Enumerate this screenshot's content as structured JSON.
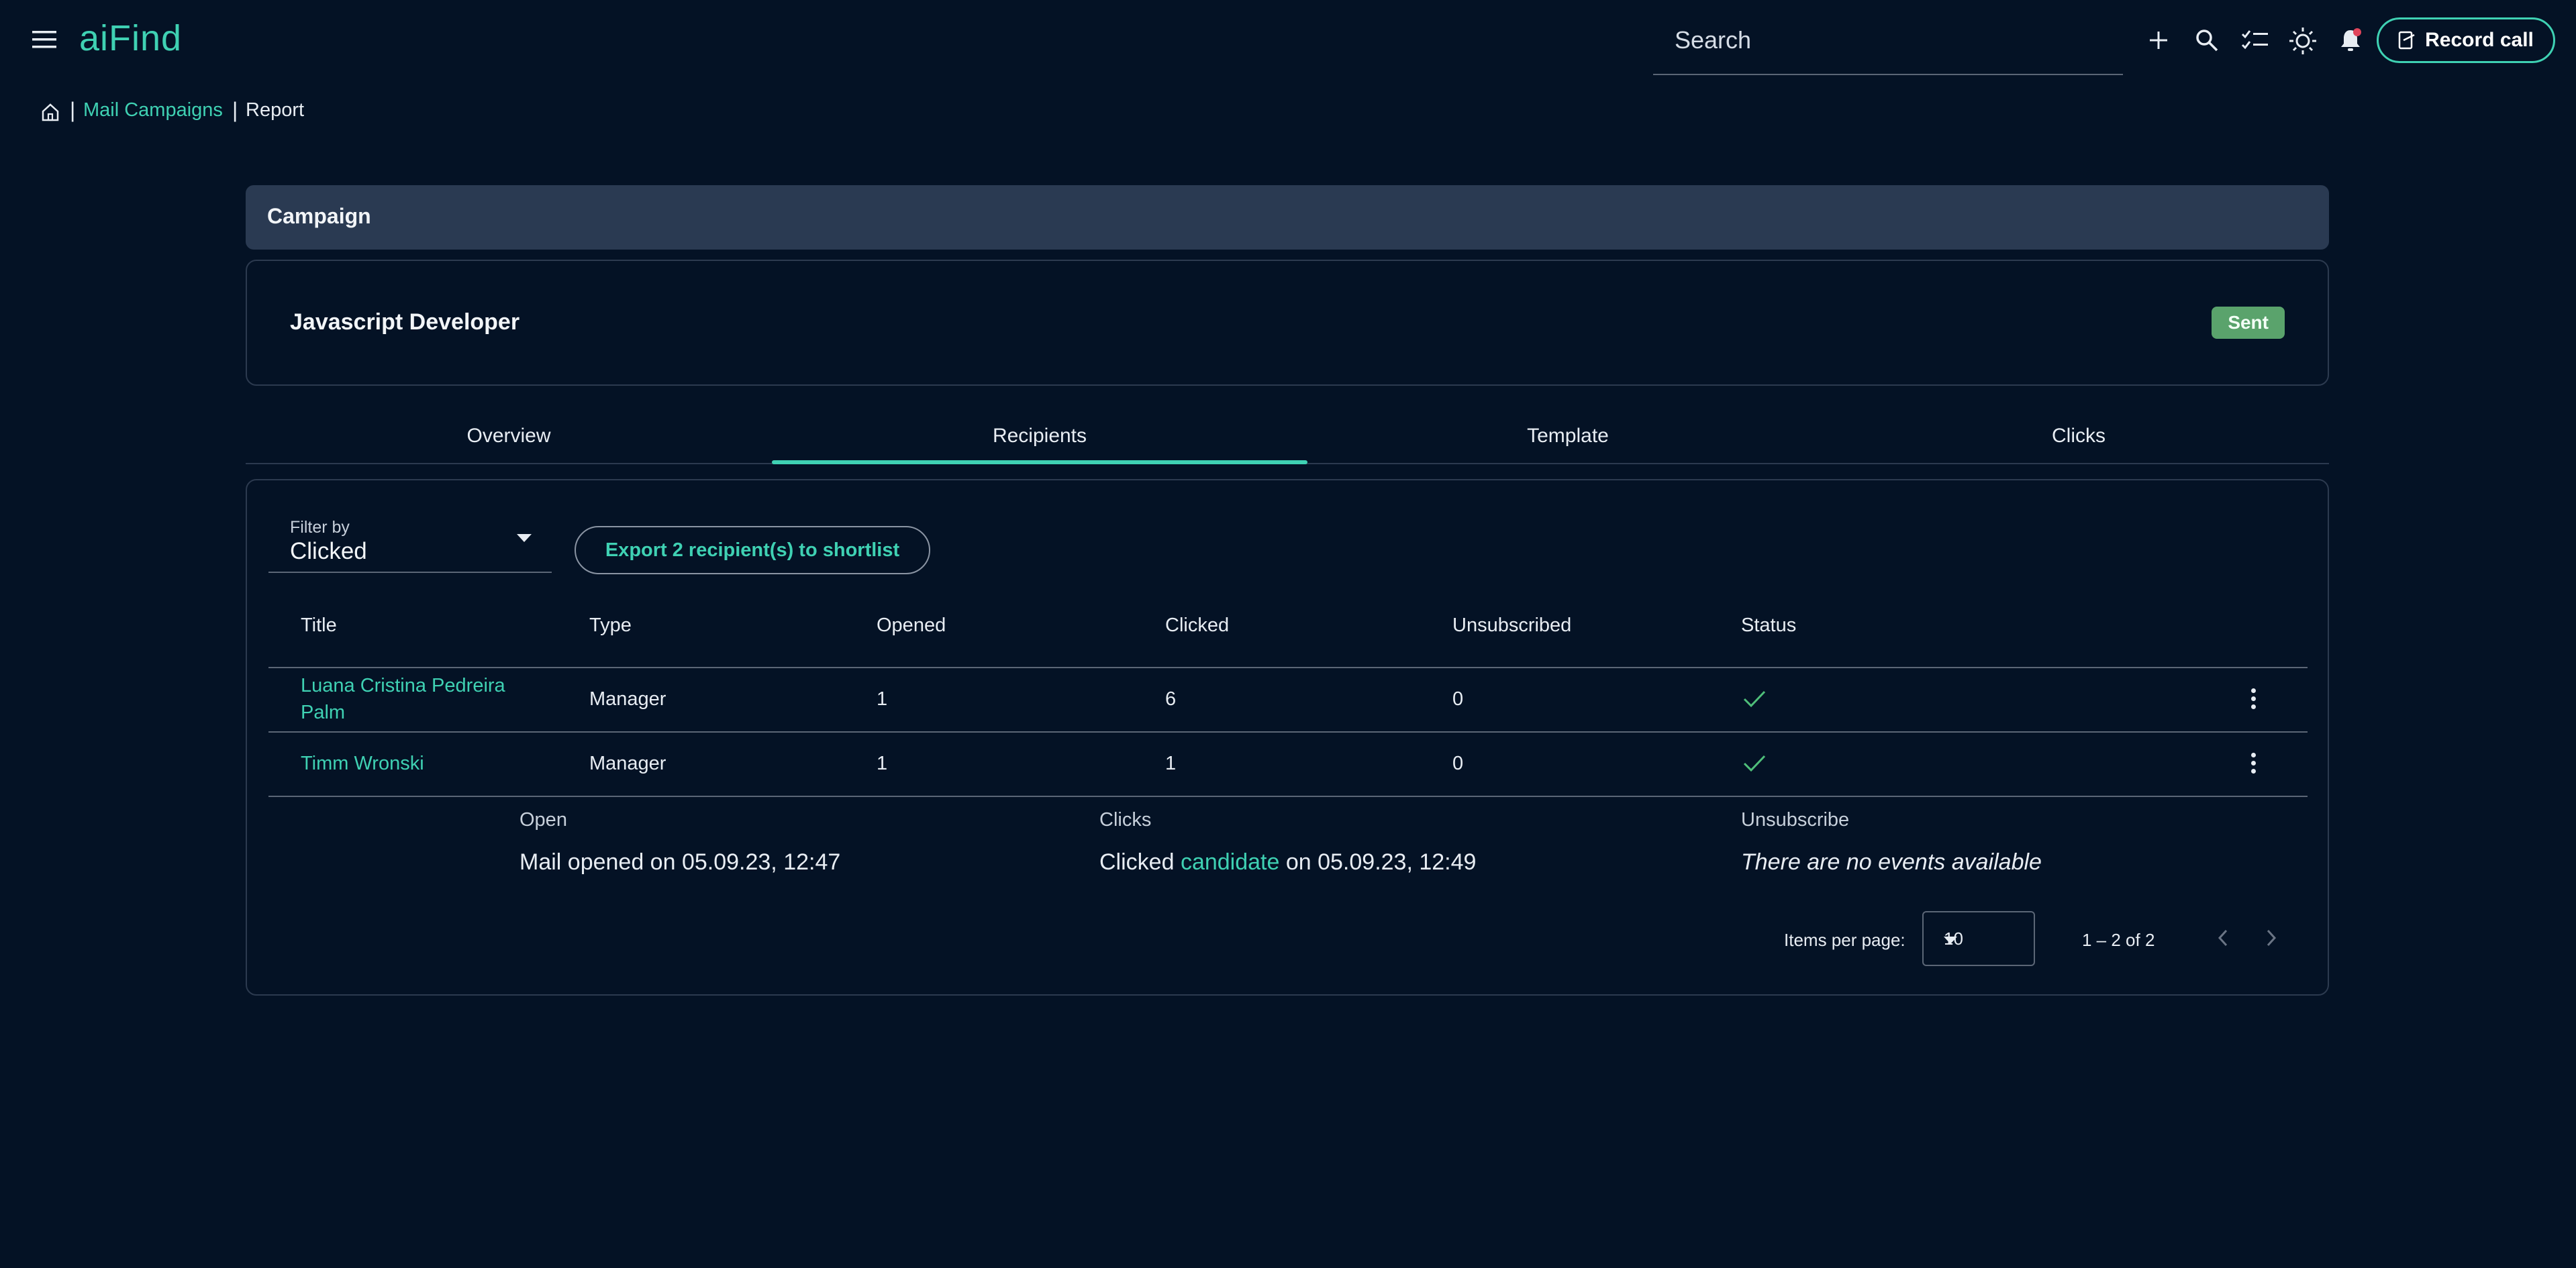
{
  "app": {
    "name": "aiFind"
  },
  "topbar": {
    "search_placeholder": "Search",
    "record_call_label": "Record call",
    "icons": [
      "menu-icon",
      "plus-icon",
      "search-icon",
      "checklist-icon",
      "theme-icon",
      "notification-bell-icon",
      "record-call-icon"
    ]
  },
  "breadcrumb": {
    "home_icon": "home-icon",
    "parent": "Mail Campaigns",
    "current": "Report"
  },
  "campaign": {
    "section_title": "Campaign",
    "name": "Javascript Developer",
    "status": "Sent"
  },
  "tabs": [
    {
      "label": "Overview",
      "active": false
    },
    {
      "label": "Recipients",
      "active": true
    },
    {
      "label": "Template",
      "active": false
    },
    {
      "label": "Clicks",
      "active": false
    }
  ],
  "filter": {
    "label": "Filter by",
    "value": "Clicked"
  },
  "export_label": "Export 2 recipient(s) to shortlist",
  "table": {
    "columns": [
      "Title",
      "Type",
      "Opened",
      "Clicked",
      "Unsubscribed",
      "Status"
    ],
    "rows": [
      {
        "title": "Luana Cristina Pedreira Palm",
        "title_line1": "Luana Cristina Pedreira",
        "title_line2": "Palm",
        "type": "Manager",
        "opened": "1",
        "clicked": "6",
        "unsubscribed": "0",
        "status_icon": "check-icon"
      },
      {
        "title": "Timm Wronski",
        "type": "Manager",
        "opened": "1",
        "clicked": "1",
        "unsubscribed": "0",
        "status_icon": "check-icon"
      }
    ]
  },
  "events": {
    "open": {
      "label": "Open",
      "text": "Mail opened on 05.09.23, 12:47"
    },
    "clicks": {
      "label": "Clicks",
      "prefix": "Clicked ",
      "link": "candidate",
      "suffix": " on 05.09.23, 12:49"
    },
    "unsubscribe": {
      "label": "Unsubscribe",
      "text": "There are no events available"
    }
  },
  "pagination": {
    "items_label": "Items per page:",
    "page_size": "10",
    "range": "1 – 2 of 2"
  },
  "colors": {
    "background": "#041225",
    "accent": "#3fd1b3",
    "badge": "#5aa36c",
    "header": "#2a3a52"
  }
}
